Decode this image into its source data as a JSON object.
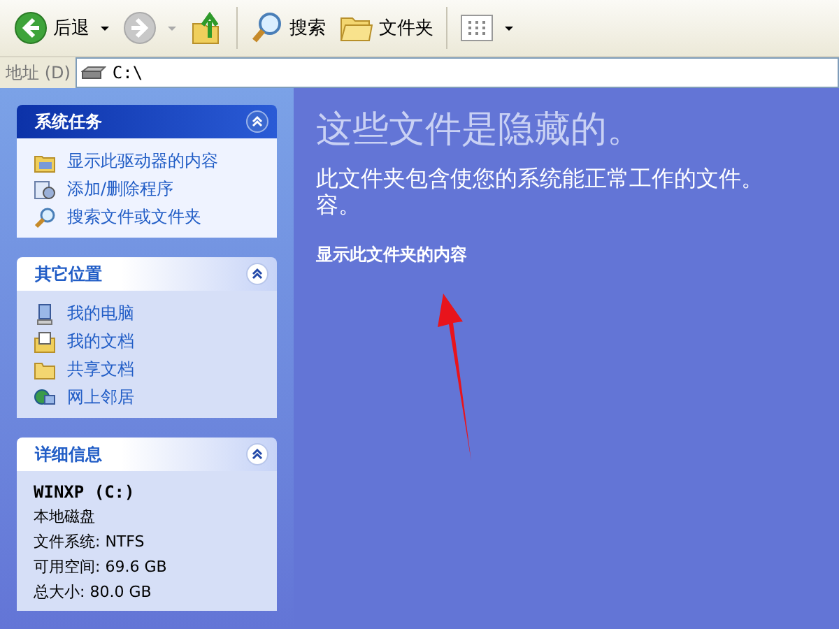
{
  "toolbar": {
    "buttons": [
      {
        "kind": "back",
        "label": "后退"
      },
      {
        "kind": "forward"
      },
      {
        "kind": "up"
      },
      {
        "kind": "search",
        "label": "搜索"
      },
      {
        "kind": "folders",
        "label": "文件夹"
      },
      {
        "kind": "views"
      }
    ]
  },
  "address": {
    "label": "地址 (D)",
    "value": "C:\\"
  },
  "sidebar": {
    "sections": [
      {
        "kind": "primary",
        "title": "系统任务",
        "expanded": true,
        "items": [
          {
            "kind": "drive",
            "label": "显示此驱动器的内容"
          },
          {
            "kind": "programs",
            "label": "添加/删除程序"
          },
          {
            "kind": "search",
            "label": "搜索文件或文件夹"
          }
        ]
      },
      {
        "kind": "normal",
        "title": "其它位置",
        "expanded": true,
        "items": [
          {
            "kind": "computer",
            "label": "我的电脑"
          },
          {
            "kind": "documents",
            "label": "我的文档"
          },
          {
            "kind": "folder",
            "label": "共享文档"
          },
          {
            "kind": "network",
            "label": "网上邻居"
          }
        ]
      },
      {
        "kind": "details",
        "title": "详细信息",
        "expanded": true,
        "name": "WINXP (C:)",
        "lines": [
          "本地磁盘",
          "文件系统: NTFS",
          "可用空间: 69.6 GB",
          "总大小: 80.0 GB"
        ]
      }
    ]
  },
  "main": {
    "heading": "这些文件是隐藏的。",
    "message_lines": [
      "此文件夹包含使您的系统能正常工作的文件。",
      "容。"
    ],
    "link": "显示此文件夹的内容"
  }
}
